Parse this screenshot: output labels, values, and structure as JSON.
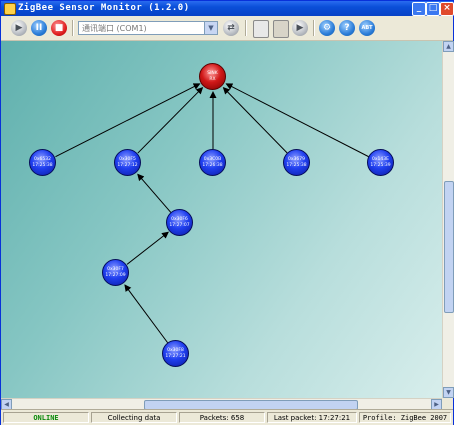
{
  "window": {
    "title": "ZigBee Sensor Monitor (1.2.0)"
  },
  "toolbar": {
    "port_value": "通讯端口 (COM1)",
    "about_label": "ABT"
  },
  "nodes": [
    {
      "id": "sink",
      "line1": "SINK",
      "line2": "RX",
      "type": "sink"
    },
    {
      "id": "n1",
      "line1": "0x6532",
      "line2": "17:25:38",
      "type": "router"
    },
    {
      "id": "n2",
      "line1": "0x30F5",
      "line2": "17:27:12",
      "type": "router"
    },
    {
      "id": "n3",
      "line1": "0x3C0B",
      "line2": "17:26:38",
      "type": "router"
    },
    {
      "id": "n4",
      "line1": "0x3679",
      "line2": "17:25:38",
      "type": "router"
    },
    {
      "id": "n5",
      "line1": "0x143E",
      "line2": "17:25:39",
      "type": "router"
    },
    {
      "id": "n6",
      "line1": "0x30F6",
      "line2": "17:27:07",
      "type": "router"
    },
    {
      "id": "n7",
      "line1": "0x30F7",
      "line2": "17:27:09",
      "type": "router"
    },
    {
      "id": "n8",
      "line1": "0x30F8",
      "line2": "17:27:21",
      "type": "end-device"
    }
  ],
  "links": [
    {
      "from": "n1",
      "to": "sink"
    },
    {
      "from": "n2",
      "to": "sink"
    },
    {
      "from": "n3",
      "to": "sink"
    },
    {
      "from": "n4",
      "to": "sink"
    },
    {
      "from": "n5",
      "to": "sink"
    },
    {
      "from": "n6",
      "to": "n2"
    },
    {
      "from": "n7",
      "to": "n6"
    },
    {
      "from": "n8",
      "to": "n7"
    }
  ],
  "status": {
    "connection": "ONLINE",
    "state": "Collecting data",
    "packets": "Packets: 658",
    "last_packet": "Last packet: 17:27:21",
    "profile": "Profile: ZigBee 2007"
  },
  "colors": {
    "online": "#0a8a0a",
    "sink": "#d01818",
    "node": "#2040f0"
  }
}
